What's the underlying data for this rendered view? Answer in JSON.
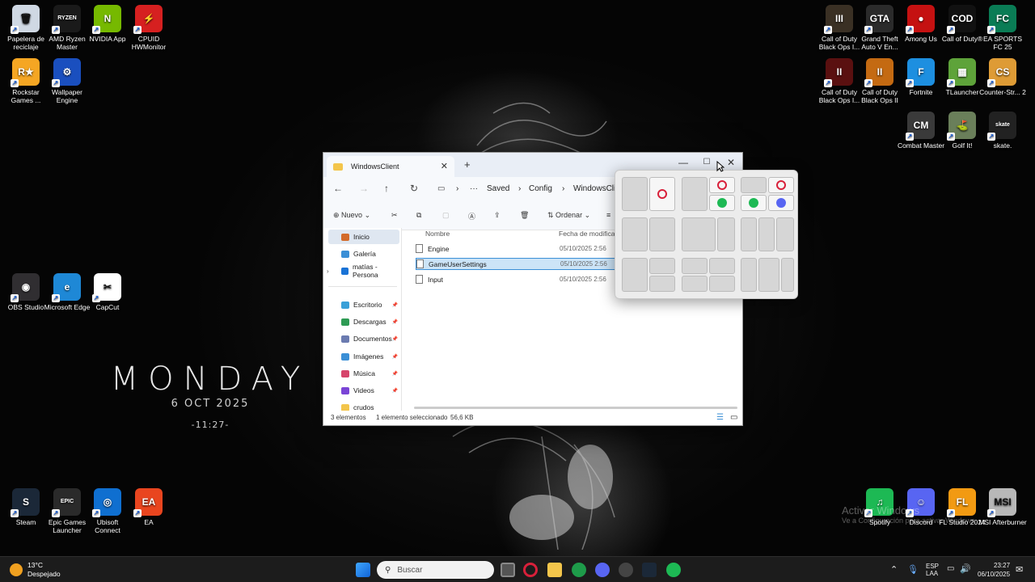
{
  "desktop": {
    "icons_left": [
      {
        "label": "Papelera de reciclaje",
        "color": "#cfd8e3",
        "glyph": "🗑"
      },
      {
        "label": "AMD Ryzen Master",
        "color": "#1a1a1a",
        "glyph": "RYZEN"
      },
      {
        "label": "NVIDIA App",
        "color": "#76b900",
        "glyph": "N"
      },
      {
        "label": "CPUID HWMonitor",
        "color": "#d62020",
        "glyph": "⚡"
      },
      {
        "label": "Rockstar Games ...",
        "color": "#f5a623",
        "glyph": "R★"
      },
      {
        "label": "Wallpaper Engine",
        "color": "#1a4fbf",
        "glyph": "⚙"
      },
      {
        "label": "OBS Studio",
        "color": "#302e31",
        "glyph": "◉"
      },
      {
        "label": "Microsoft Edge",
        "color": "#1e88d6",
        "glyph": "e"
      },
      {
        "label": "CapCut",
        "color": "#ffffff",
        "glyph": "✂"
      },
      {
        "label": "Steam",
        "color": "#1b2838",
        "glyph": "S"
      },
      {
        "label": "Epic Games Launcher",
        "color": "#2a2a2a",
        "glyph": "EPIC"
      },
      {
        "label": "Ubisoft Connect",
        "color": "#0f6fd0",
        "glyph": "◎"
      },
      {
        "label": "EA",
        "color": "#e9451f",
        "glyph": "EA"
      }
    ],
    "icons_right": [
      {
        "label": "Call of Duty Black Ops I...",
        "color": "#3a3024",
        "glyph": "III"
      },
      {
        "label": "Grand Theft Auto V En...",
        "color": "#2b2b2b",
        "glyph": "GTA"
      },
      {
        "label": "Among Us",
        "color": "#c51111",
        "glyph": "●"
      },
      {
        "label": "Call of Duty®",
        "color": "#111111",
        "glyph": "COD"
      },
      {
        "label": "EA SPORTS FC 25",
        "color": "#0a7c55",
        "glyph": "FC"
      },
      {
        "label": "Call of Duty Black Ops I...",
        "color": "#5a1010",
        "glyph": "II"
      },
      {
        "label": "Call of Duty Black Ops II",
        "color": "#c46a12",
        "glyph": "II"
      },
      {
        "label": "Fortnite",
        "color": "#1d8fe0",
        "glyph": "F"
      },
      {
        "label": "TLauncher",
        "color": "#5ea33a",
        "glyph": "▦"
      },
      {
        "label": "Counter-Str... 2",
        "color": "#de9b35",
        "glyph": "CS"
      },
      {
        "label": "Combat Master",
        "color": "#3a3a3a",
        "glyph": "CM"
      },
      {
        "label": "Golf It!",
        "color": "#6a7f5a",
        "glyph": "⛳"
      },
      {
        "label": "skate.",
        "color": "#222",
        "glyph": "skate"
      },
      {
        "label": "Spotify",
        "color": "#1db954",
        "glyph": "♫"
      },
      {
        "label": "Discord",
        "color": "#5865f2",
        "glyph": "☺"
      },
      {
        "label": "FL Studio 2024",
        "color": "#f29a12",
        "glyph": "FL"
      },
      {
        "label": "MSI Afterburner",
        "color": "#b8b8b8",
        "glyph": "MSI"
      }
    ],
    "clock_widget": {
      "day": "MONDAY",
      "date": "6 OCT 2025",
      "time": "-11:27-"
    },
    "activation": {
      "title": "Activar Windows",
      "subtitle": "Ve a Configuración para activar Windows."
    }
  },
  "explorer": {
    "tab_title": "WindowsClient",
    "breadcrumb": [
      "Saved",
      "Config",
      "WindowsCli"
    ],
    "commands": {
      "new": "Nuevo",
      "sort": "Ordenar"
    },
    "nav_items": [
      {
        "label": "Inicio",
        "color": "#d36b2b"
      },
      {
        "label": "Galería",
        "color": "#3b8fd6"
      },
      {
        "label": "matías - Persona",
        "color": "#1a73d6"
      },
      {
        "label": "Escritorio",
        "color": "#3aa0d8"
      },
      {
        "label": "Descargas",
        "color": "#2e9b54"
      },
      {
        "label": "Documentos",
        "color": "#6b7bb0"
      },
      {
        "label": "Imágenes",
        "color": "#3b8fd6"
      },
      {
        "label": "Música",
        "color": "#d6456b"
      },
      {
        "label": "Videos",
        "color": "#7a45d6"
      },
      {
        "label": "crudos",
        "color": "#f3c54b"
      }
    ],
    "columns": {
      "name": "Nombre",
      "date": "Fecha de modificac"
    },
    "files": [
      {
        "name": "Engine",
        "date": "05/10/2025 2:56"
      },
      {
        "name": "GameUserSettings",
        "date": "05/10/2025 2:56"
      },
      {
        "name": "Input",
        "date": "05/10/2025 2:56"
      }
    ],
    "status": {
      "count": "3 elementos",
      "selection": "1 elemento seleccionado",
      "size": "56,6 KB"
    }
  },
  "taskbar": {
    "weather": {
      "temp": "13°C",
      "condition": "Despejado"
    },
    "search_placeholder": "Buscar",
    "language": {
      "lang": "ESP",
      "layout": "LAA"
    },
    "time": "23:27",
    "date": "06/10/2025"
  }
}
